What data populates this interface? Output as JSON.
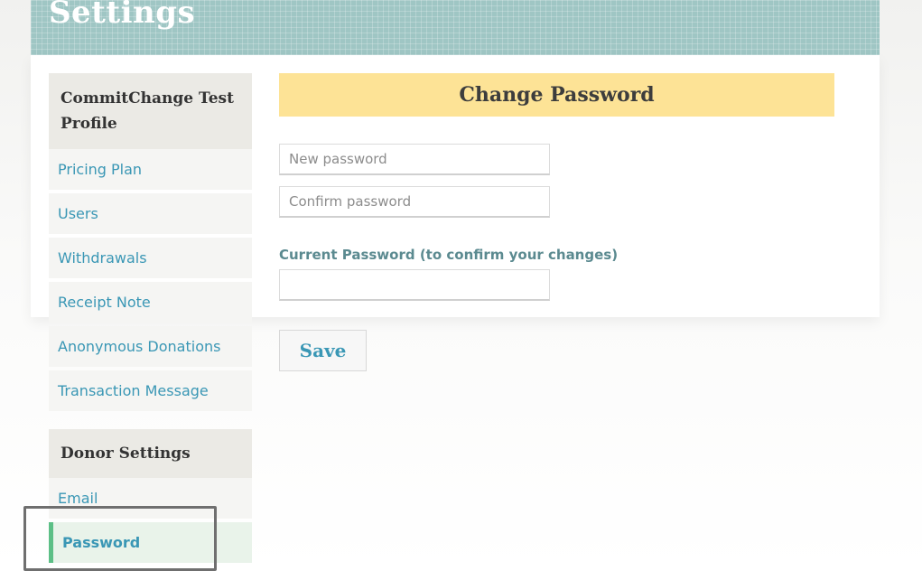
{
  "header": {
    "title": "Settings"
  },
  "sidebar": {
    "profile_section": {
      "title": "CommitChange Test Profile",
      "items": [
        {
          "label": "Pricing Plan"
        },
        {
          "label": "Users"
        },
        {
          "label": "Withdrawals"
        },
        {
          "label": "Receipt Note"
        },
        {
          "label": "Anonymous Donations"
        },
        {
          "label": "Transaction Message"
        }
      ]
    },
    "donor_section": {
      "title": "Donor Settings",
      "items": [
        {
          "label": "Email"
        },
        {
          "label": "Password",
          "active": true
        }
      ]
    }
  },
  "form": {
    "title": "Change Password",
    "new_password": {
      "placeholder": "New password",
      "value": ""
    },
    "confirm_password": {
      "placeholder": "Confirm password",
      "value": ""
    },
    "current_password_label": "Current Password (to confirm your changes)",
    "current_password": {
      "value": ""
    },
    "save_label": "Save"
  },
  "colors": {
    "banner": "#9fc6c4",
    "title_bar": "#fde396",
    "link": "#3a97b5",
    "active_marker": "#5cbf86"
  }
}
